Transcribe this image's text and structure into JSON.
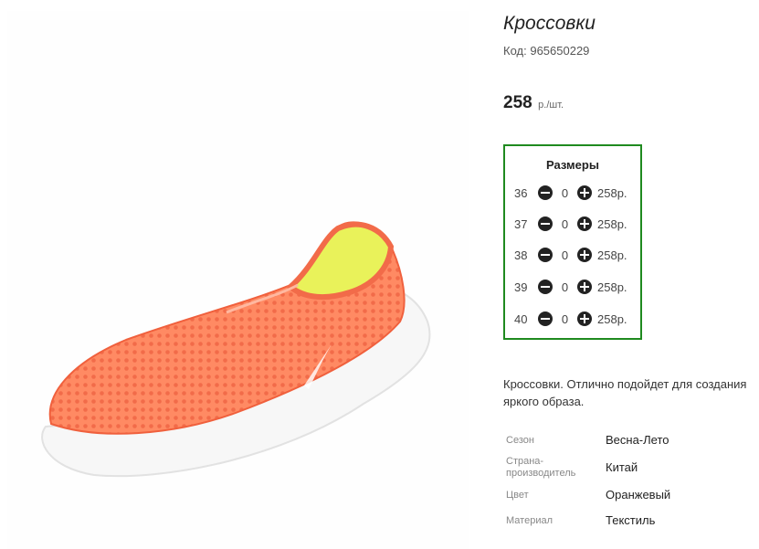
{
  "product": {
    "title": "Кроссовки",
    "code_label": "Код:",
    "code_value": "965650229",
    "price": "258",
    "price_unit": "р./шт."
  },
  "sizes": {
    "title": "Размеры",
    "rows": [
      {
        "size": "36",
        "qty": "0",
        "price": "258р."
      },
      {
        "size": "37",
        "qty": "0",
        "price": "258р."
      },
      {
        "size": "38",
        "qty": "0",
        "price": "258р."
      },
      {
        "size": "39",
        "qty": "0",
        "price": "258р."
      },
      {
        "size": "40",
        "qty": "0",
        "price": "258р."
      }
    ]
  },
  "description": "Кроссовки. Отлично подойдет для создания яркого образа.",
  "attributes": [
    {
      "label": "Сезон",
      "value": "Весна-Лето"
    },
    {
      "label": "Страна-производитель",
      "value": "Китай"
    },
    {
      "label": "Цвет",
      "value": "Оранжевый"
    },
    {
      "label": "Материал",
      "value": "Текстиль"
    }
  ],
  "colors": {
    "accent_border": "#1f8a1f",
    "shoe_body": "#ff8a63",
    "shoe_sole": "#ffffff",
    "shoe_lining": "#e9f25a"
  },
  "icons": {
    "minus": "minus-circle-icon",
    "plus": "plus-circle-icon"
  }
}
